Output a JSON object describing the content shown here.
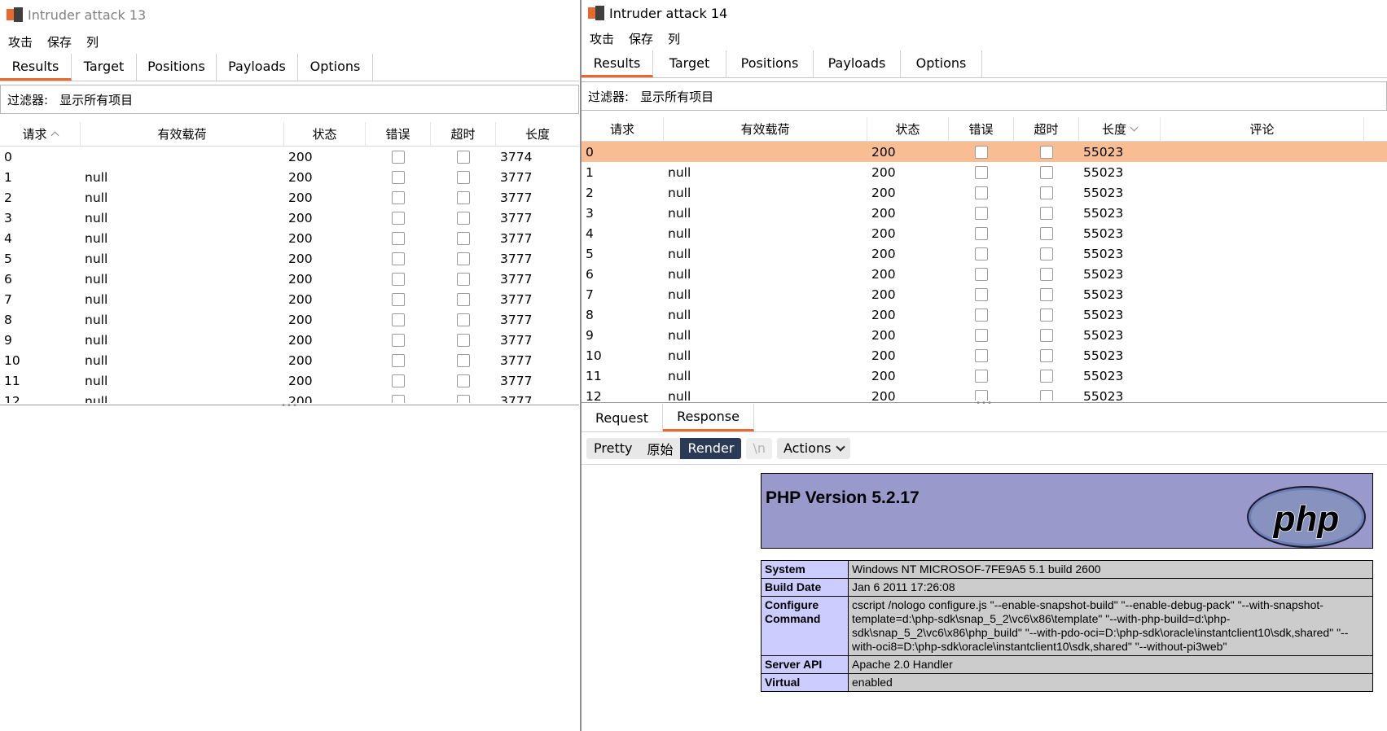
{
  "left_window": {
    "title": "Intruder attack 13",
    "menu": [
      "攻击",
      "保存",
      "列"
    ],
    "tabs": [
      "Results",
      "Target",
      "Positions",
      "Payloads",
      "Options"
    ],
    "active_tab": "Results",
    "filter_label": "过滤器:",
    "filter_value": "显示所有项目",
    "columns": [
      "请求",
      "有效载荷",
      "状态",
      "错误",
      "超时",
      "长度"
    ],
    "sorted_column": "请求",
    "rows": [
      {
        "req": "0",
        "payload": "",
        "status": "200",
        "length": "3774"
      },
      {
        "req": "1",
        "payload": "null",
        "status": "200",
        "length": "3777"
      },
      {
        "req": "2",
        "payload": "null",
        "status": "200",
        "length": "3777"
      },
      {
        "req": "3",
        "payload": "null",
        "status": "200",
        "length": "3777"
      },
      {
        "req": "4",
        "payload": "null",
        "status": "200",
        "length": "3777"
      },
      {
        "req": "5",
        "payload": "null",
        "status": "200",
        "length": "3777"
      },
      {
        "req": "6",
        "payload": "null",
        "status": "200",
        "length": "3777"
      },
      {
        "req": "7",
        "payload": "null",
        "status": "200",
        "length": "3777"
      },
      {
        "req": "8",
        "payload": "null",
        "status": "200",
        "length": "3777"
      },
      {
        "req": "9",
        "payload": "null",
        "status": "200",
        "length": "3777"
      },
      {
        "req": "10",
        "payload": "null",
        "status": "200",
        "length": "3777"
      },
      {
        "req": "11",
        "payload": "null",
        "status": "200",
        "length": "3777"
      },
      {
        "req": "12",
        "payload": "null",
        "status": "200",
        "length": "3777"
      }
    ]
  },
  "right_window": {
    "title": "Intruder attack 14",
    "menu": [
      "攻击",
      "保存",
      "列"
    ],
    "tabs": [
      "Results",
      "Target",
      "Positions",
      "Payloads",
      "Options"
    ],
    "active_tab": "Results",
    "filter_label": "过滤器:",
    "filter_value": "显示所有项目",
    "columns": [
      "请求",
      "有效载荷",
      "状态",
      "错误",
      "超时",
      "长度",
      "评论"
    ],
    "sorted_column": "长度",
    "rows": [
      {
        "req": "0",
        "payload": "",
        "status": "200",
        "length": "55023",
        "selected": true
      },
      {
        "req": "1",
        "payload": "null",
        "status": "200",
        "length": "55023"
      },
      {
        "req": "2",
        "payload": "null",
        "status": "200",
        "length": "55023"
      },
      {
        "req": "3",
        "payload": "null",
        "status": "200",
        "length": "55023"
      },
      {
        "req": "4",
        "payload": "null",
        "status": "200",
        "length": "55023"
      },
      {
        "req": "5",
        "payload": "null",
        "status": "200",
        "length": "55023"
      },
      {
        "req": "6",
        "payload": "null",
        "status": "200",
        "length": "55023"
      },
      {
        "req": "7",
        "payload": "null",
        "status": "200",
        "length": "55023"
      },
      {
        "req": "8",
        "payload": "null",
        "status": "200",
        "length": "55023"
      },
      {
        "req": "9",
        "payload": "null",
        "status": "200",
        "length": "55023"
      },
      {
        "req": "10",
        "payload": "null",
        "status": "200",
        "length": "55023"
      },
      {
        "req": "11",
        "payload": "null",
        "status": "200",
        "length": "55023"
      },
      {
        "req": "12",
        "payload": "null",
        "status": "200",
        "length": "55023"
      }
    ],
    "sub_tabs": [
      "Request",
      "Response"
    ],
    "active_sub_tab": "Response",
    "view_modes": [
      "Pretty",
      "原始",
      "Render"
    ],
    "active_view_mode": "Render",
    "newline_button": "\\n",
    "actions_button": "Actions",
    "render": {
      "php_title": "PHP Version 5.2.17",
      "logo_text": "php",
      "info": [
        {
          "key": "System",
          "value": "Windows NT MICROSOF-7FE9A5 5.1 build 2600"
        },
        {
          "key": "Build Date",
          "value": "Jan 6 2011 17:26:08"
        },
        {
          "key": "Configure Command",
          "value": "cscript /nologo configure.js \"--enable-snapshot-build\" \"--enable-debug-pack\" \"--with-snapshot-template=d:\\php-sdk\\snap_5_2\\vc6\\x86\\template\" \"--with-php-build=d:\\php-sdk\\snap_5_2\\vc6\\x86\\php_build\" \"--with-pdo-oci=D:\\php-sdk\\oracle\\instantclient10\\sdk,shared\" \"--with-oci8=D:\\php-sdk\\oracle\\instantclient10\\sdk,shared\" \"--without-pi3web\""
        },
        {
          "key": "Server API",
          "value": "Apache 2.0 Handler"
        },
        {
          "key": "Virtual",
          "value": "enabled"
        }
      ]
    }
  },
  "colors": {
    "accent": "#e8692e",
    "selected_row": "#f9bd94",
    "php_header": "#9999cc",
    "php_key": "#ccccff",
    "php_value": "#cccccc",
    "render_active": "#2b3a55"
  }
}
